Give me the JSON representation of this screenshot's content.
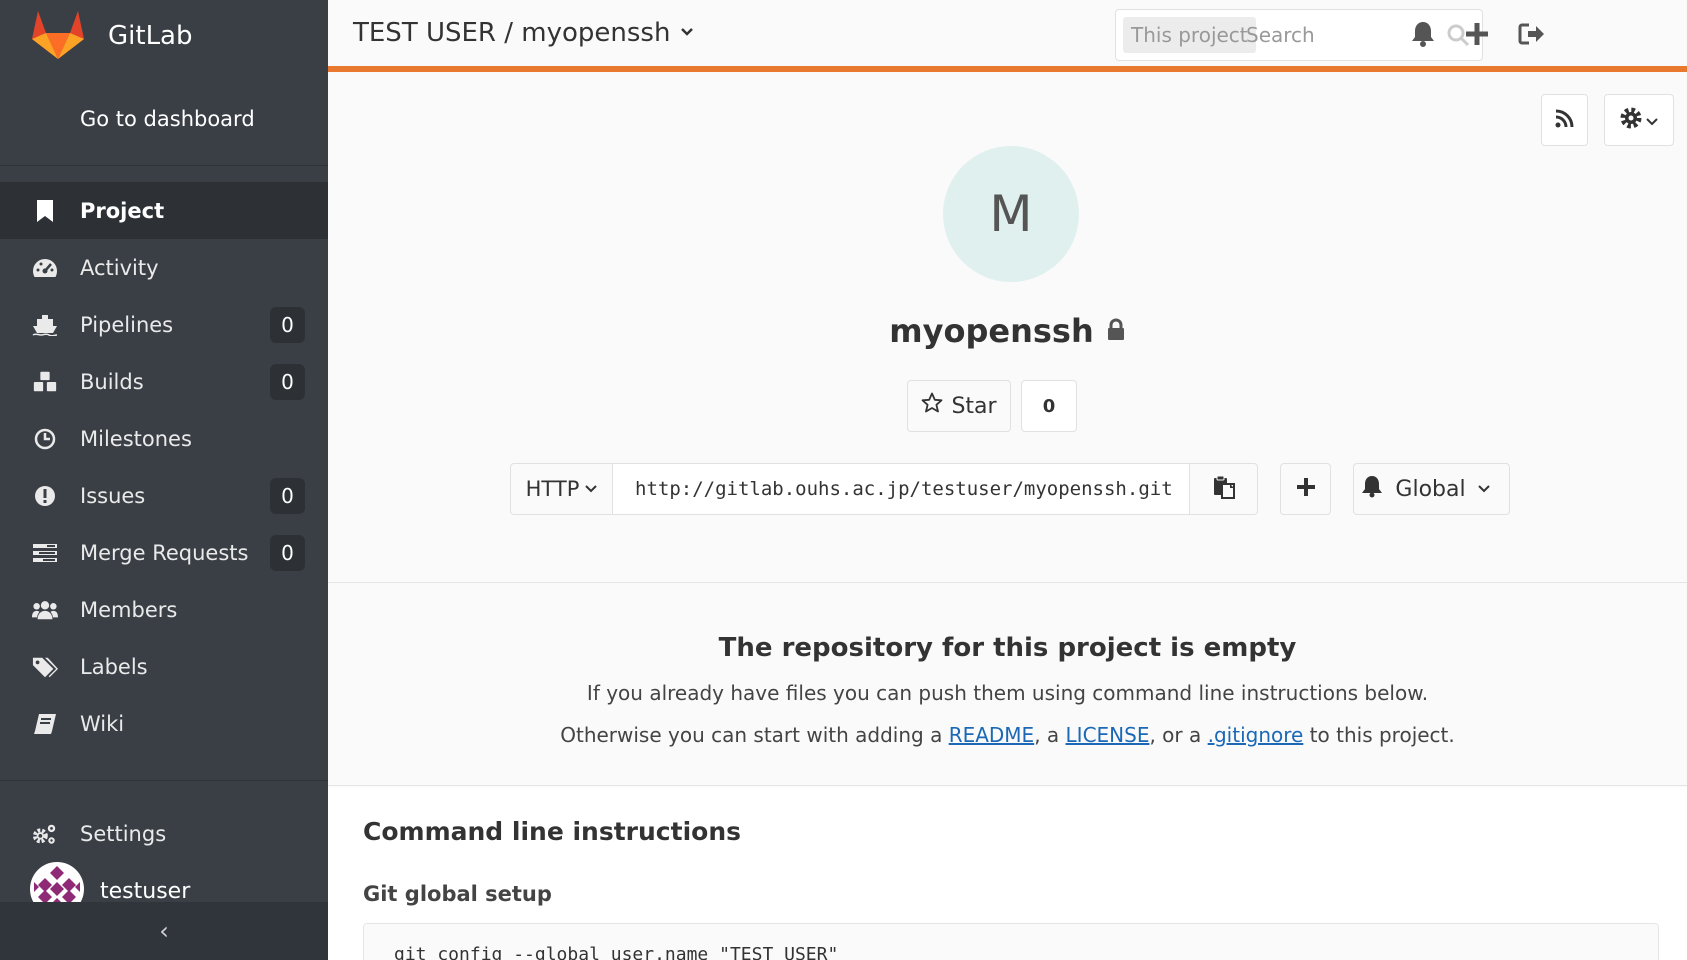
{
  "sidebar": {
    "brand": "GitLab",
    "dashboard_link": "Go to dashboard",
    "items": [
      {
        "label": "Project",
        "badge": null,
        "icon": "bookmark-icon"
      },
      {
        "label": "Activity",
        "badge": null,
        "icon": "dashboard-icon"
      },
      {
        "label": "Pipelines",
        "badge": "0",
        "icon": "ship-icon"
      },
      {
        "label": "Builds",
        "badge": "0",
        "icon": "cubes-icon"
      },
      {
        "label": "Milestones",
        "badge": null,
        "icon": "clock-icon"
      },
      {
        "label": "Issues",
        "badge": "0",
        "icon": "exclamation-circle-icon"
      },
      {
        "label": "Merge Requests",
        "badge": "0",
        "icon": "tasks-icon"
      },
      {
        "label": "Members",
        "badge": null,
        "icon": "users-icon"
      },
      {
        "label": "Labels",
        "badge": null,
        "icon": "tags-icon"
      },
      {
        "label": "Wiki",
        "badge": null,
        "icon": "book-icon"
      }
    ],
    "settings": "Settings",
    "user": "testuser",
    "collapse": "‹"
  },
  "header": {
    "breadcrumb": "TEST USER / myopenssh",
    "search_scope": "This project",
    "search_placeholder": "Search"
  },
  "project": {
    "avatar_letter": "M",
    "name": "myopenssh",
    "star_label": "Star",
    "star_count": "0",
    "protocol": "HTTP",
    "clone_url": "http://gitlab.ouhs.ac.jp/testuser/myopenssh.git",
    "notification_level": "Global"
  },
  "empty_repo": {
    "title": "The repository for this project is empty",
    "line1": "If you already have files you can push them using command line instructions below.",
    "line2_prefix": "Otherwise you can start with adding a ",
    "readme": "README",
    "sep1": ", a ",
    "license": "LICENSE",
    "sep2": ", or a ",
    "gitignore": ".gitignore",
    "line2_suffix": " to this project."
  },
  "cli": {
    "title": "Command line instructions",
    "subtitle": "Git global setup",
    "code_line": "git config --global user.name \"TEST USER\""
  },
  "colors": {
    "sidebar_bg": "#3a3f46",
    "accent": "#e9792f",
    "link": "#1b69b6"
  }
}
